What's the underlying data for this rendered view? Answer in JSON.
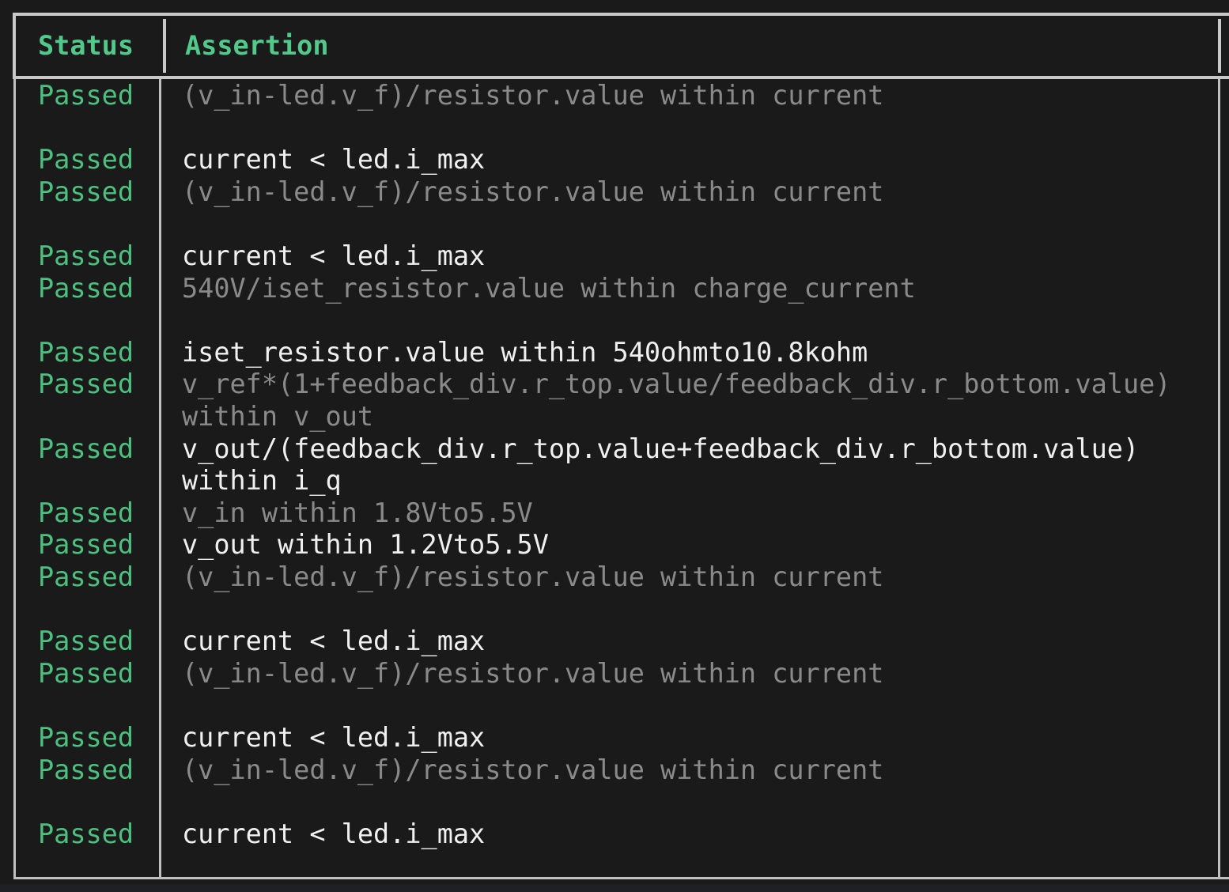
{
  "table": {
    "headers": {
      "status": "Status",
      "assertion": "Assertion"
    },
    "colors": {
      "status_green": "#4cc07f",
      "header_green": "#52c98a",
      "text_grey": "#8a8a8a",
      "text_white": "#f0f0f0",
      "border": "#c8c8c8",
      "background": "#1a1a1a"
    },
    "rows": [
      {
        "status": "Passed",
        "assertion": "(v_in-led.v_f)/resistor.value within current",
        "tone": "grey"
      },
      {
        "status": "Passed",
        "assertion": "current < led.i_max",
        "tone": "white"
      },
      {
        "status": "Passed",
        "assertion": "(v_in-led.v_f)/resistor.value within current",
        "tone": "grey"
      },
      {
        "status": "Passed",
        "assertion": "current < led.i_max",
        "tone": "white"
      },
      {
        "status": "Passed",
        "assertion": "540V/iset_resistor.value within charge_current",
        "tone": "grey"
      },
      {
        "status": "Passed",
        "assertion": "iset_resistor.value within 540ohmto10.8kohm",
        "tone": "white"
      },
      {
        "status": "Passed",
        "assertion": "v_ref*(1+feedback_div.r_top.value/feedback_div.r_bottom.value)\nwithin v_out",
        "tone": "grey"
      },
      {
        "status": "Passed",
        "assertion": "v_out/(feedback_div.r_top.value+feedback_div.r_bottom.value)\nwithin i_q",
        "tone": "white"
      },
      {
        "status": "Passed",
        "assertion": "v_in within 1.8Vto5.5V",
        "tone": "grey"
      },
      {
        "status": "Passed",
        "assertion": "v_out within 1.2Vto5.5V",
        "tone": "white"
      },
      {
        "status": "Passed",
        "assertion": "(v_in-led.v_f)/resistor.value within current",
        "tone": "grey"
      },
      {
        "status": "Passed",
        "assertion": "current < led.i_max",
        "tone": "white"
      },
      {
        "status": "Passed",
        "assertion": "(v_in-led.v_f)/resistor.value within current",
        "tone": "grey"
      },
      {
        "status": "Passed",
        "assertion": "current < led.i_max",
        "tone": "white"
      },
      {
        "status": "Passed",
        "assertion": "(v_in-led.v_f)/resistor.value within current",
        "tone": "grey"
      },
      {
        "status": "Passed",
        "assertion": "current < led.i_max",
        "tone": "white"
      }
    ]
  }
}
